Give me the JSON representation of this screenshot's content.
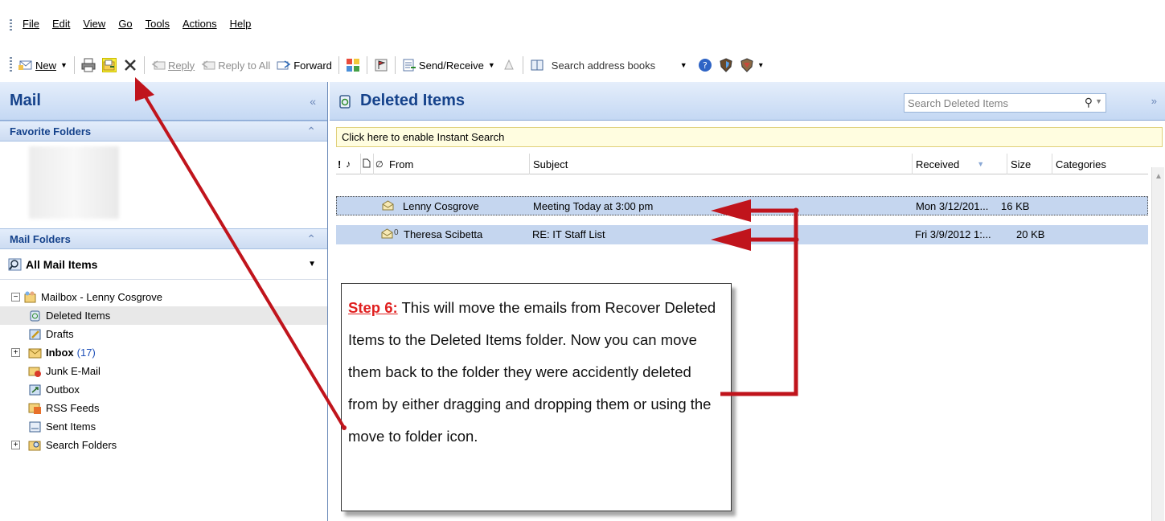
{
  "menu": [
    "File",
    "Edit",
    "View",
    "Go",
    "Tools",
    "Actions",
    "Help"
  ],
  "toolbar": {
    "new_label": "New",
    "reply_label": "Reply",
    "reply_all_label": "Reply to All",
    "forward_label": "Forward",
    "send_receive_label": "Send/Receive",
    "address_search": "Search address books"
  },
  "left": {
    "title": "Mail",
    "favorite_folders": "Favorite Folders",
    "mail_folders": "Mail Folders",
    "all_mail_items": "All Mail Items",
    "tree": [
      {
        "label": "Mailbox - Lenny Cosgrove",
        "icon": "mailbox-icon"
      },
      {
        "label": "Deleted Items",
        "icon": "trash-icon"
      },
      {
        "label": "Drafts",
        "icon": "drafts-icon"
      },
      {
        "label": "Inbox",
        "icon": "inbox-icon",
        "count": "(17)"
      },
      {
        "label": "Junk E-Mail",
        "icon": "junk-icon"
      },
      {
        "label": "Outbox",
        "icon": "outbox-icon"
      },
      {
        "label": "RSS Feeds",
        "icon": "rss-icon"
      },
      {
        "label": "Sent Items",
        "icon": "sent-icon"
      },
      {
        "label": "Search Folders",
        "icon": "search-folder-icon"
      }
    ]
  },
  "right": {
    "folder_title": "Deleted Items",
    "search_placeholder": "Search Deleted Items",
    "instant_search": "Click here to enable Instant Search",
    "columns": {
      "from": "From",
      "subject": "Subject",
      "received": "Received",
      "size": "Size",
      "categories": "Categories"
    },
    "rows": [
      {
        "from": "Lenny Cosgrove",
        "subject": "Meeting Today at 3:00 pm",
        "received": "Mon 3/12/201...",
        "size": "16 KB",
        "attachment": false
      },
      {
        "from": "Theresa Scibetta",
        "subject": "RE: IT Staff List",
        "received": "Fri 3/9/2012 1:...",
        "size": "20 KB",
        "attachment": true
      }
    ]
  },
  "callout": {
    "step": "Step 6:",
    "text": " This will move the emails from Recover Deleted Items to the Deleted Items folder. Now you can move them back to the folder they were accidently deleted from by either dragging and dropping them or using the move to folder icon."
  },
  "colors": {
    "arrow": "#c0141c",
    "header_blue": "#15428b",
    "selected_row": "#c5d6ef"
  }
}
